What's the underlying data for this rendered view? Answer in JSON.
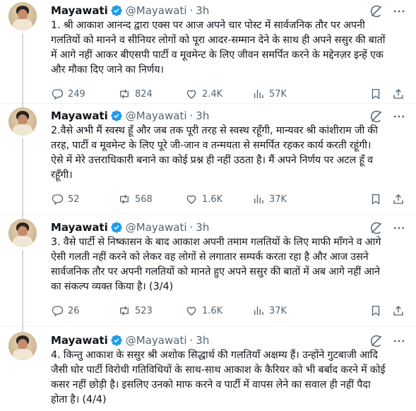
{
  "tweets": [
    {
      "author": "Mayawati",
      "handle": "@Mayawati",
      "separator": "·",
      "time": "3h",
      "text": "1. श्री आकाश आनन्द द्वारा एक्स पर आज अपने चार पोस्ट में सार्वजनिक तौर पर अपनी\nगलतियों को मानने व सीनियर लोगों को पूरा आदर-सम्मान देने के साथ ही अपने ससुर की बातों\nमें आगे नहीं आकर बीएसपी पार्टी व मूवमेन्ट के लिए जीवन समर्पित करने के मद्देनज़र इन्हें एक\nऔर मौका दिए जाने का निर्णय।",
      "replies": "249",
      "reposts": "824",
      "likes": "2.4K",
      "views": "57K"
    },
    {
      "author": "Mayawati",
      "handle": "@Mayawati",
      "separator": "·",
      "time": "3h",
      "text": "2.वैसे अभी मैं स्वस्थ हूँ और जब तक पूरी तरह से स्वस्थ रहूँगी, मान्यवर श्री कांशीराम जी की\nतरह, पार्टी व मूवमेन्ट के लिए पूरे जी-जान व तन्मयता से समर्पित रहकर कार्य करती रहूंगी।\nऐसे में मेरे उत्तराधिकारी बनाने का कोई प्रश्न ही नहीं उठता है। मैं अपने निर्णय पर अटल हूँ व\nरहूँगी।",
      "replies": "52",
      "reposts": "568",
      "likes": "1.6K",
      "views": "37K"
    },
    {
      "author": "Mayawati",
      "handle": "@Mayawati",
      "separator": "·",
      "time": "3h",
      "text": "3. वैसे पार्टी से निष्कासन के बाद आकाश अपनी तमाम गलतियों के लिए माफी माँगने व आगे\nऐसी गलती नहीं करने को लेकर वह लोगों से लगातार सम्पर्क करता रहा है और आज उसने\nसार्वजनिक तौर पर अपनी गलतियों को मानते हुए अपने ससुर की बातों में अब आगे नहीं आने\nका संकल्प व्यक्त किया है। (3/4)",
      "replies": "26",
      "reposts": "523",
      "likes": "1.6K",
      "views": "37K"
    },
    {
      "author": "Mayawati",
      "handle": "@Mayawati",
      "separator": "·",
      "time": "3h",
      "text": "4. किन्तु आकाश के ससुर श्री अशोक सिद्धार्थ की गलतियाँ अक्षम्य हैं। उन्होंने गुटबाजी आदि\nजैसी घोर पार्टी विरोधी गतिविधियों के साथ-साथ आकाश के कैरियर को भी बर्बाद करने में कोई\nकसर नहीं छोड़ी है। इसलिए उनको माफ करने व पार्टी में वापस लेने का सवाल ही नहीं पैदा\nहोता है। (4/4)"
    }
  ],
  "colors": {
    "text": "#0f1419",
    "secondary": "#536471",
    "verified": "#1d9bf0",
    "divider": "#eff3f4",
    "thread": "#cfd9de"
  },
  "icons": [
    "verified-badge-icon",
    "grok-icon",
    "more-icon",
    "reply-icon",
    "repost-icon",
    "like-icon",
    "views-icon",
    "bookmark-icon",
    "share-icon"
  ]
}
